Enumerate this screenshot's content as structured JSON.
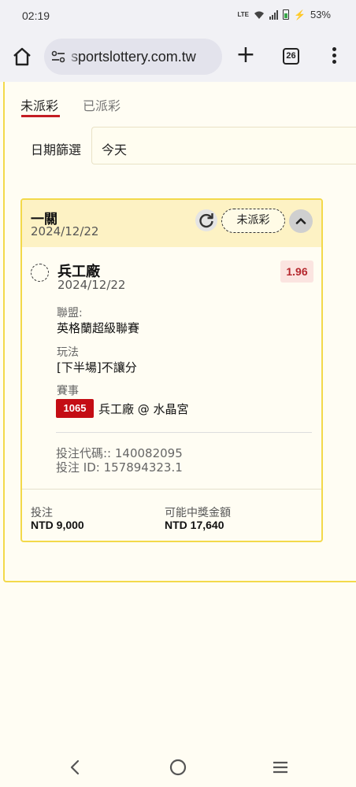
{
  "status": {
    "time": "02:19",
    "battery": "53%",
    "network": "LTE"
  },
  "browser": {
    "url": "sportslottery.com.tw",
    "tab_count": "26"
  },
  "tabs": [
    {
      "label": "未派彩",
      "active": true
    },
    {
      "label": "已派彩",
      "active": false
    }
  ],
  "filter": {
    "label": "日期篩選",
    "value": "今天"
  },
  "ticket": {
    "title": "一關",
    "date": "2024/12/22",
    "status": "未派彩",
    "selection": {
      "team": "兵工廠",
      "date": "2024/12/22",
      "odds": "1.96",
      "league_label": "聯盟:",
      "league": "英格蘭超級聯賽",
      "market_label": "玩法",
      "market": "[下半場]不讓分",
      "event_label": "賽事",
      "event_code": "1065",
      "event": "兵工廠 @ 水晶宮"
    },
    "bet_code": "投注代碼:: 140082095",
    "bet_id": "投注 ID: 157894323.1",
    "stake_label": "投注",
    "stake": "NTD 9,000",
    "payout_label": "可能中獎金額",
    "payout": "NTD 17,640"
  },
  "colors": {
    "accent_red": "#c41d23",
    "border_yellow": "#f3d94a",
    "header_bg": "#fdf2c4",
    "odds_bg": "#fbe4e0"
  }
}
